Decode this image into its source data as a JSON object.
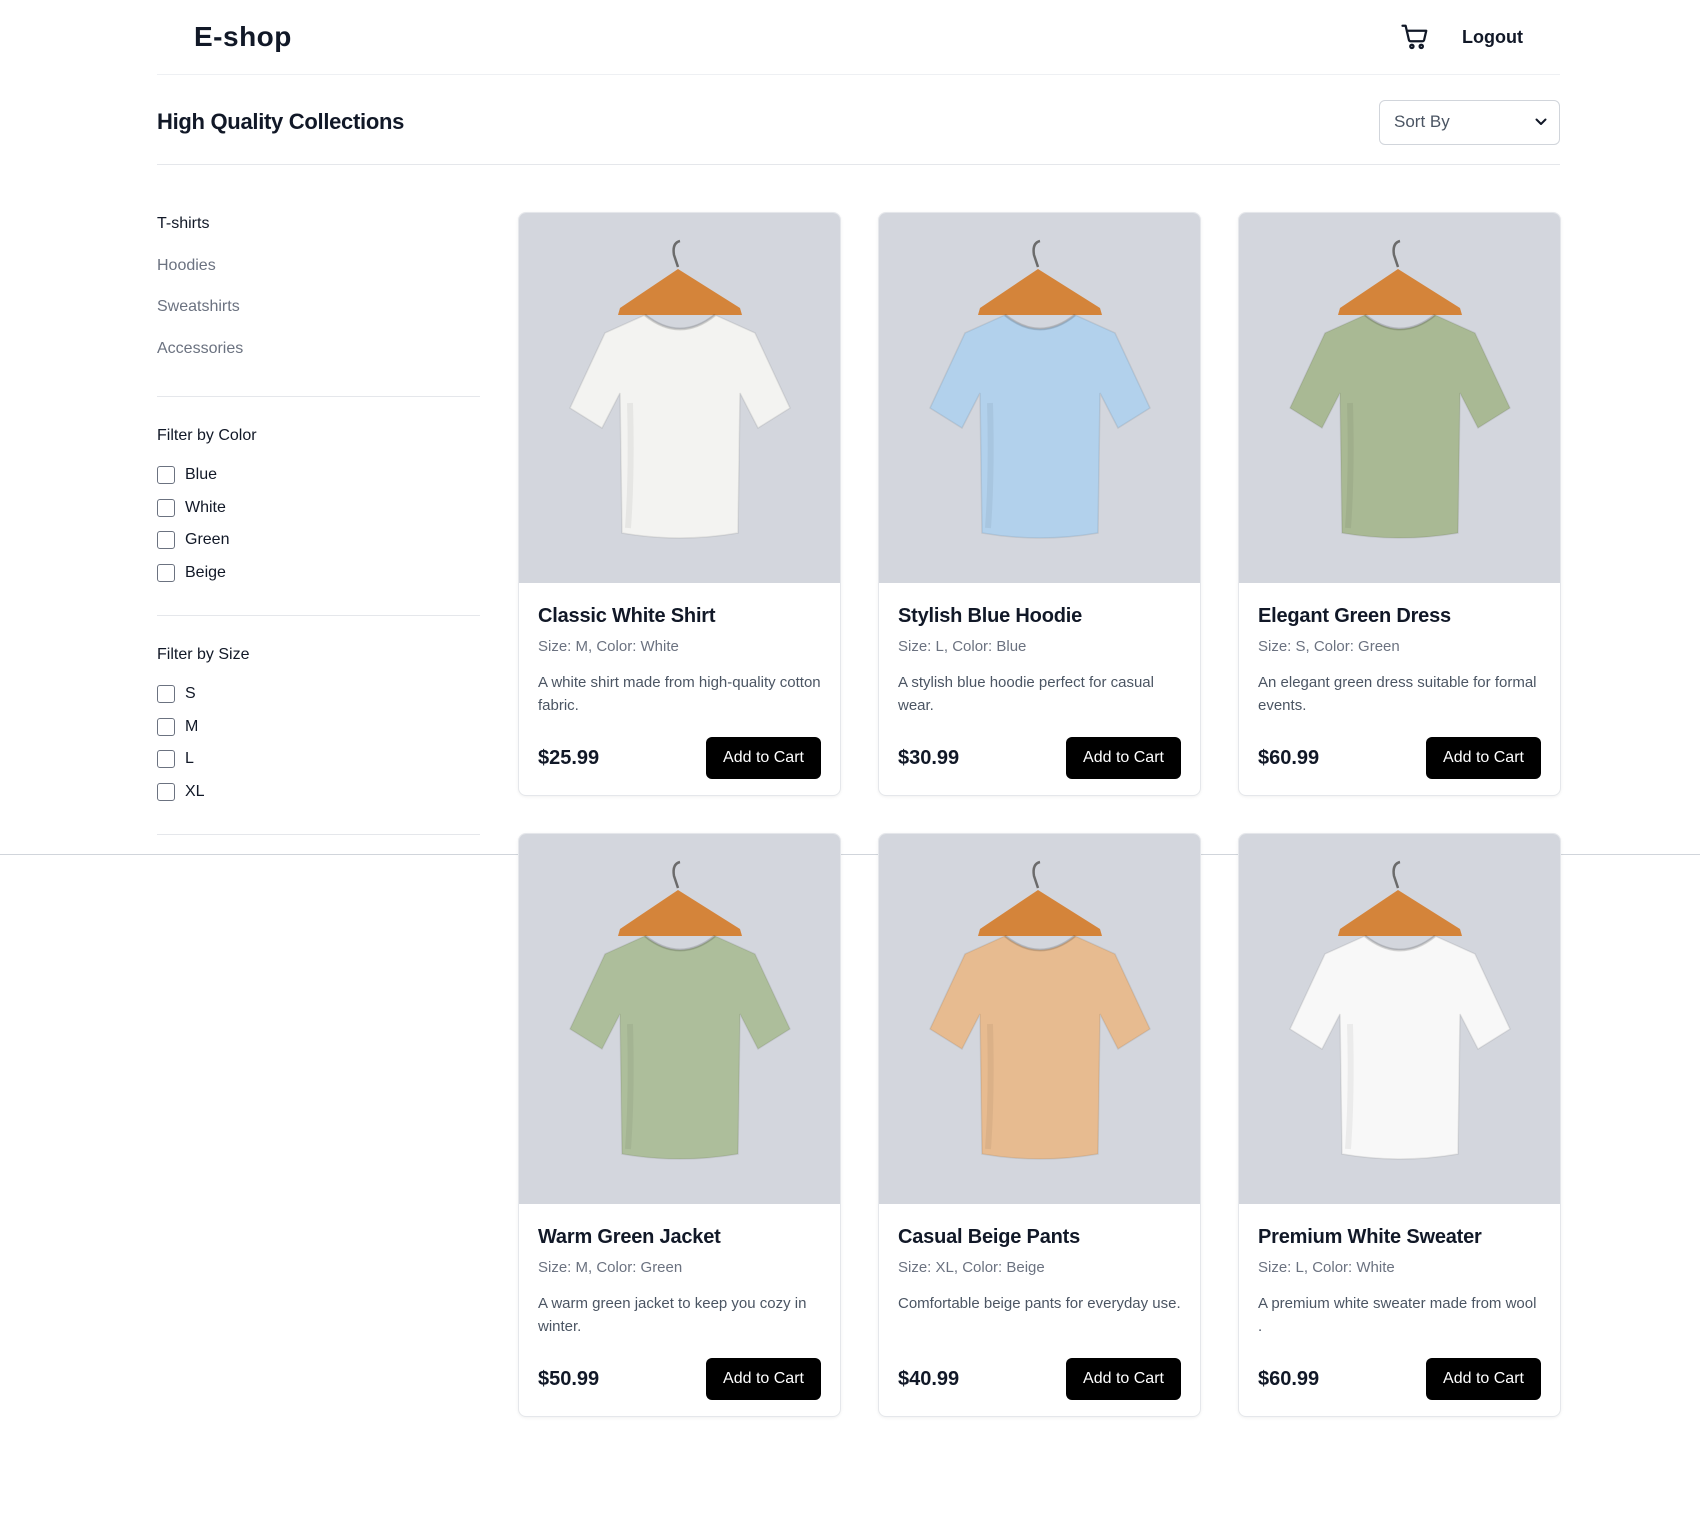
{
  "header": {
    "brand": "E-shop",
    "cart_icon": "cart-icon",
    "logout_label": "Logout"
  },
  "collection": {
    "title": "High Quality Collections",
    "sort_label": "Sort By"
  },
  "sidebar": {
    "categories": [
      "T-shirts",
      "Hoodies",
      "Sweatshirts",
      "Accessories"
    ],
    "color_filter": {
      "title": "Filter by Color",
      "options": [
        "Blue",
        "White",
        "Green",
        "Beige"
      ]
    },
    "size_filter": {
      "title": "Filter by Size",
      "options": [
        "S",
        "M",
        "L",
        "XL"
      ]
    }
  },
  "products": [
    {
      "name": "Classic White Shirt",
      "meta": "Size: M, Color: White",
      "description": "A white shirt made from high-quality cotton fabric.",
      "price": "$25.99",
      "button": "Add to Cart",
      "shirt_color": "#f3f3f1"
    },
    {
      "name": "Stylish Blue Hoodie",
      "meta": "Size: L, Color: Blue",
      "description": "A stylish blue hoodie perfect for casual wear.",
      "price": "$30.99",
      "button": "Add to Cart",
      "shirt_color": "#b2d1ec"
    },
    {
      "name": "Elegant Green Dress",
      "meta": "Size: S, Color: Green",
      "description": "An elegant green dress suitable for formal events.",
      "price": "$60.99",
      "button": "Add to Cart",
      "shirt_color": "#a9b994"
    },
    {
      "name": "Warm Green Jacket",
      "meta": "Size: M, Color: Green",
      "description": "A warm green jacket to keep you cozy in winter.",
      "price": "$50.99",
      "button": "Add to Cart",
      "shirt_color": "#adbe9b"
    },
    {
      "name": "Casual Beige Pants",
      "meta": "Size: XL, Color: Beige",
      "description": "Comfortable beige pants for everyday use.",
      "price": "$40.99",
      "button": "Add to Cart",
      "shirt_color": "#e7bb90"
    },
    {
      "name": "Premium White Sweater",
      "meta": "Size: L, Color: White",
      "description": "A premium white sweater made from wool .",
      "price": "$60.99",
      "button": "Add to Cart",
      "shirt_color": "#f8f8f8"
    }
  ],
  "colors": {
    "accent": "#000000",
    "image_bg": "#d3d6dd",
    "hanger": "#d4843a"
  }
}
